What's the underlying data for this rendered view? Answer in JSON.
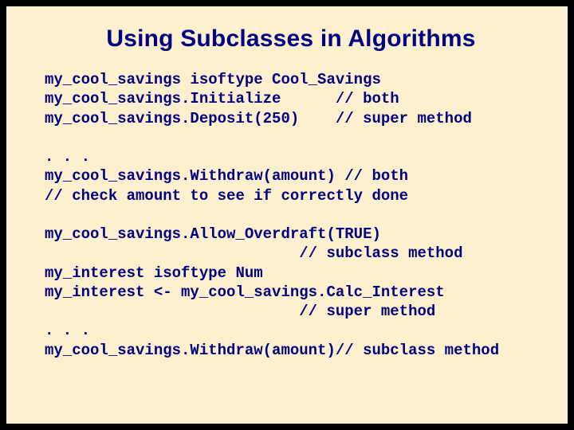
{
  "title": "Using Subclasses in Algorithms",
  "block1": "my_cool_savings isoftype Cool_Savings\nmy_cool_savings.Initialize      // both\nmy_cool_savings.Deposit(250)    // super method",
  "block2": ". . .\nmy_cool_savings.Withdraw(amount) // both\n// check amount to see if correctly done",
  "block3": "my_cool_savings.Allow_Overdraft(TRUE)\n                            // subclass method\nmy_interest isoftype Num\nmy_interest <- my_cool_savings.Calc_Interest\n                            // super method\n. . .\nmy_cool_savings.Withdraw(amount)// subclass method"
}
